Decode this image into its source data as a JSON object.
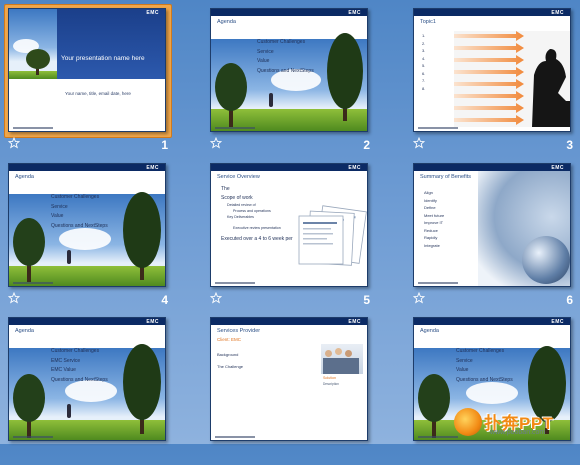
{
  "slides": [
    {
      "num": "1",
      "selected": true,
      "title": "Your presentation name here",
      "subtitle": "Your name, title, email date, here",
      "brand": "EMC"
    },
    {
      "num": "2",
      "title": "Agenda",
      "brand": "EMC",
      "items": [
        "Customer Challenges",
        "Service",
        "Value",
        "Questions and NextSteps"
      ]
    },
    {
      "num": "3",
      "title": "Topic1",
      "brand": "EMC",
      "items": [
        "1.",
        "2.",
        "3.",
        "4.",
        "5.",
        "6.",
        "7.",
        "8."
      ]
    },
    {
      "num": "4",
      "title": "Agenda",
      "brand": "EMC",
      "items": [
        "Customer Challenges",
        "Service",
        "Value",
        "Questions and NextSteps"
      ]
    },
    {
      "num": "5",
      "title": "Service Overview",
      "brand": "EMC",
      "items": [
        "The",
        "Scope of work",
        "Detailed review of",
        "Process and operations",
        "Key Deliverables",
        "Executive review presentation",
        "Executed over a 4 to 6 week per"
      ]
    },
    {
      "num": "6",
      "title": "Summary of Benefits",
      "brand": "EMC",
      "items": [
        "Align",
        "Identify",
        "Define",
        "Meet future",
        "Improve IT",
        "Reduce",
        "Rapidly",
        "Integrate"
      ]
    },
    {
      "num": "7",
      "title": "Agenda",
      "brand": "EMC",
      "items": [
        "Customer Challenges",
        "EMC Service",
        "EMC Value",
        "Questions and NextSteps"
      ]
    },
    {
      "num": "8",
      "title": "Services Provider",
      "brand": "EMC",
      "subtitle": "Client: EMC",
      "items": [
        "Background",
        "The Challenge"
      ],
      "photo_caption": [
        "Solution",
        "Description"
      ]
    },
    {
      "num": "9",
      "title": "Agenda",
      "brand": "EMC",
      "items": [
        "Customer Challenges",
        "Service",
        "Value",
        "Questions and NextSteps"
      ]
    }
  ],
  "watermark": {
    "text": "扑奔PPT",
    "sub": "www.pooban.com"
  },
  "colors": {
    "accent": "#0b2a64",
    "selection": "#f0a64a",
    "desktop": "#6d9bd3"
  }
}
